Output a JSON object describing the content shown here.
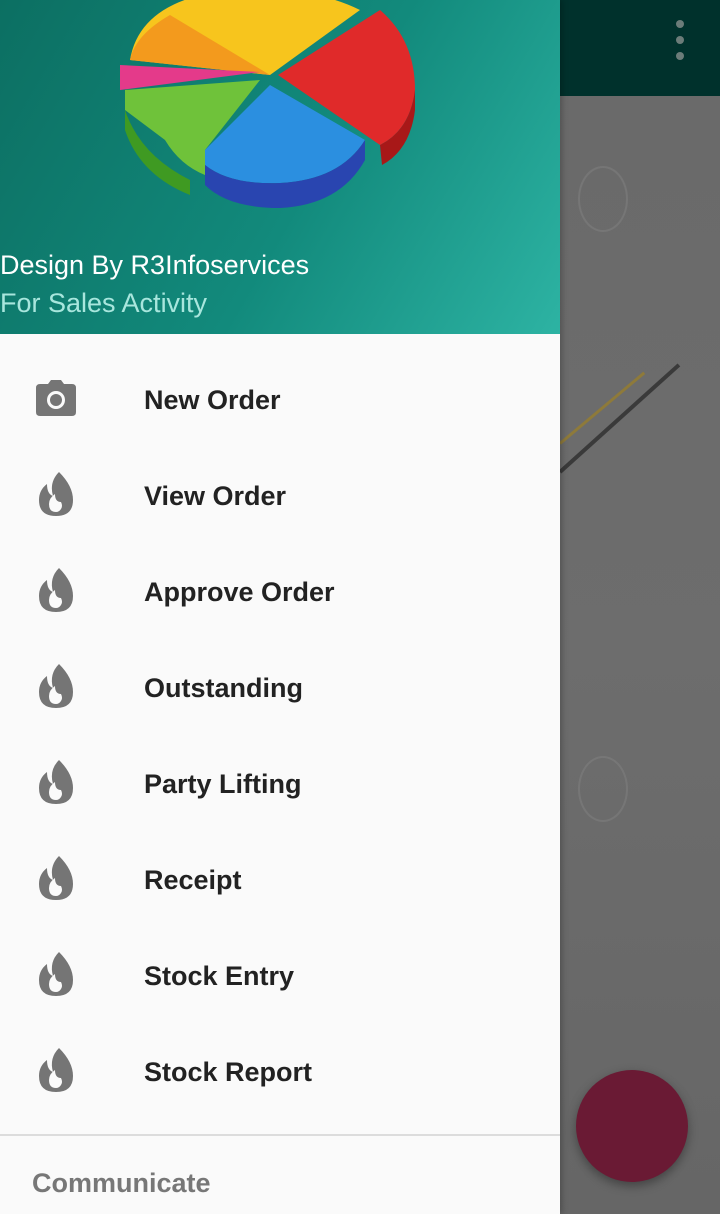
{
  "header": {
    "title": "Design By R3Infoservices",
    "subtitle": "For Sales Activity",
    "logo_icon": "pie-chart-logo"
  },
  "menu": {
    "items": [
      {
        "label": "New Order",
        "icon": "camera-icon"
      },
      {
        "label": "View Order",
        "icon": "flame-icon"
      },
      {
        "label": "Approve Order",
        "icon": "flame-icon"
      },
      {
        "label": "Outstanding",
        "icon": "flame-icon"
      },
      {
        "label": "Party Lifting",
        "icon": "flame-icon"
      },
      {
        "label": "Receipt",
        "icon": "flame-icon"
      },
      {
        "label": "Stock Entry",
        "icon": "flame-icon"
      },
      {
        "label": "Stock Report",
        "icon": "flame-icon"
      }
    ]
  },
  "section": {
    "title": "Communicate"
  },
  "colors": {
    "header_start": "#0c6f62",
    "header_end": "#2db3a3",
    "toolbar": "#00312c",
    "fab": "#6a1a34",
    "icon": "#757575"
  }
}
